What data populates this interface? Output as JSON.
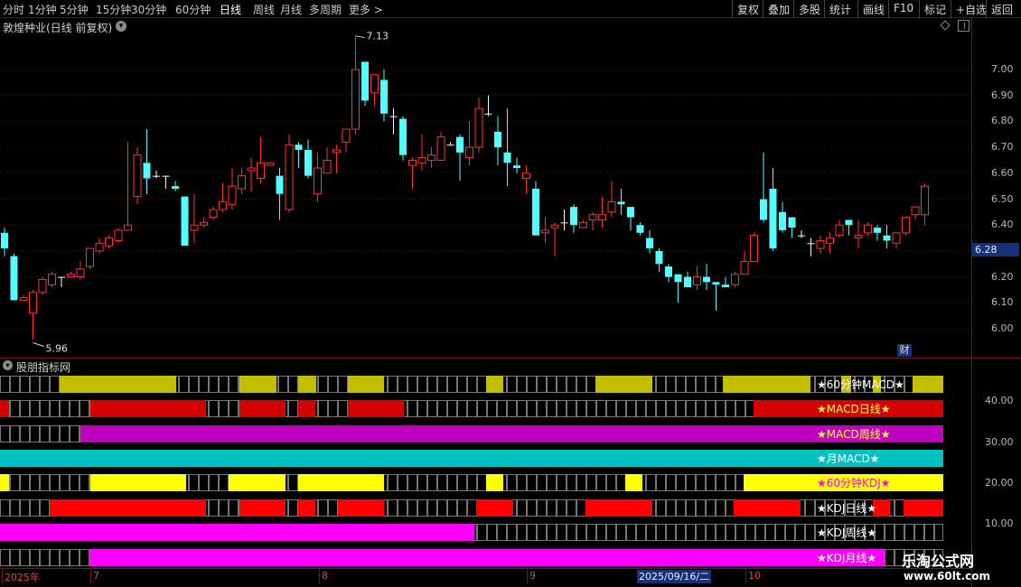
{
  "toolbar": {
    "periods": [
      "分时",
      "1分钟",
      "5分钟",
      "15分钟",
      "30分钟",
      "60分钟",
      "日线",
      "周线",
      "月线",
      "多周期",
      "更多 >"
    ],
    "active": "日线",
    "right": [
      "复权",
      "叠加",
      "多股",
      "统计",
      "画线",
      "F10",
      "标记",
      "+自选",
      "返回"
    ]
  },
  "chart_title": "敦煌种业(日线 前复权)",
  "ind_title": "股朋指标网",
  "current_price": "6.28",
  "cai_label": "财",
  "extremes": {
    "high": "7.13",
    "low": "5.96"
  },
  "price_axis": [
    "7.00",
    "6.90",
    "6.80",
    "6.70",
    "6.60",
    "6.50",
    "6.40",
    "6.30",
    "6.20",
    "6.10",
    "6.00"
  ],
  "ind_axis": [
    "40.00",
    "30.00",
    "20.00",
    "10.00"
  ],
  "date_labels": [
    "2025年",
    "7",
    "8",
    "9",
    "10"
  ],
  "cursor_date": "2025/09/16/二",
  "indicator_labels": [
    "★60分钟MACD★",
    "★MACD日线★",
    "★MACD周线★",
    "★月MACD★",
    "★60分钟KDJ★",
    "★KDJ日线★",
    "★KDJ周线★",
    "★KDJ月线★"
  ],
  "watermark": {
    "name": "乐淘公式网",
    "url": "www.60lt.com"
  },
  "colors": {
    "up": "#ff3232",
    "down": "#54ffff",
    "bg": "#000000",
    "grid": "#7a1414",
    "olive": "#c2be00",
    "red": "#d40000",
    "purple": "#c000c0",
    "teal": "#00c0c0",
    "yellow": "#ffff00",
    "brightred": "#ff0000",
    "magenta": "#ff00ff"
  },
  "chart_data": {
    "type": "candlestick",
    "ylim": [
      5.95,
      7.15
    ],
    "candles": [
      [
        6.37,
        6.31,
        6.39,
        6.28
      ],
      [
        6.28,
        6.11,
        6.29,
        6.11
      ],
      [
        6.11,
        6.12,
        6.13,
        6.11
      ],
      [
        6.06,
        6.14,
        6.15,
        5.96
      ],
      [
        6.14,
        6.19,
        6.2,
        6.13
      ],
      [
        6.17,
        6.21,
        6.22,
        6.16
      ],
      [
        6.2,
        6.2,
        6.2,
        6.16
      ],
      [
        6.2,
        6.21,
        6.22,
        6.2
      ],
      [
        6.2,
        6.23,
        6.26,
        6.19
      ],
      [
        6.24,
        6.31,
        6.31,
        6.23
      ],
      [
        6.3,
        6.33,
        6.35,
        6.29
      ],
      [
        6.32,
        6.35,
        6.36,
        6.31
      ],
      [
        6.34,
        6.38,
        6.39,
        6.33
      ],
      [
        6.38,
        6.4,
        6.72,
        6.38
      ],
      [
        6.51,
        6.67,
        6.7,
        6.48
      ],
      [
        6.64,
        6.58,
        6.77,
        6.52
      ],
      [
        6.59,
        6.59,
        6.61,
        6.58
      ],
      [
        6.59,
        6.59,
        6.59,
        6.54
      ],
      [
        6.55,
        6.54,
        6.57,
        6.53
      ],
      [
        6.51,
        6.32,
        6.51,
        6.32
      ],
      [
        6.38,
        6.4,
        6.52,
        6.33
      ],
      [
        6.4,
        6.41,
        6.43,
        6.39
      ],
      [
        6.43,
        6.46,
        6.47,
        6.42
      ],
      [
        6.46,
        6.49,
        6.56,
        6.45
      ],
      [
        6.48,
        6.55,
        6.62,
        6.46
      ],
      [
        6.54,
        6.59,
        6.62,
        6.52
      ],
      [
        6.61,
        6.62,
        6.66,
        6.53
      ],
      [
        6.58,
        6.64,
        6.74,
        6.56
      ],
      [
        6.63,
        6.64,
        6.64,
        6.64
      ],
      [
        6.59,
        6.52,
        6.62,
        6.42
      ],
      [
        6.46,
        6.71,
        6.75,
        6.45
      ],
      [
        6.71,
        6.69,
        6.72,
        6.62
      ],
      [
        6.69,
        6.59,
        6.73,
        6.58
      ],
      [
        6.52,
        6.62,
        6.68,
        6.49
      ],
      [
        6.6,
        6.65,
        6.7,
        6.6
      ],
      [
        6.68,
        6.69,
        6.71,
        6.6
      ],
      [
        6.72,
        6.77,
        6.77,
        6.68
      ],
      [
        6.77,
        7.0,
        7.13,
        6.75
      ],
      [
        7.03,
        6.88,
        7.02,
        6.86
      ],
      [
        6.91,
        6.98,
        6.98,
        6.86
      ],
      [
        6.96,
        6.83,
        7.0,
        6.8
      ],
      [
        6.82,
        6.82,
        6.85,
        6.75
      ],
      [
        6.81,
        6.67,
        6.82,
        6.65
      ],
      [
        6.63,
        6.65,
        6.66,
        6.54
      ],
      [
        6.64,
        6.66,
        6.75,
        6.61
      ],
      [
        6.65,
        6.67,
        6.7,
        6.62
      ],
      [
        6.65,
        6.74,
        6.76,
        6.65
      ],
      [
        6.71,
        6.71,
        6.72,
        6.71
      ],
      [
        6.74,
        6.68,
        6.75,
        6.57
      ],
      [
        6.66,
        6.7,
        6.8,
        6.63
      ],
      [
        6.7,
        6.85,
        6.89,
        6.68
      ],
      [
        6.83,
        6.83,
        6.9,
        6.82
      ],
      [
        6.76,
        6.7,
        6.82,
        6.63
      ],
      [
        6.68,
        6.64,
        6.85,
        6.55
      ],
      [
        6.63,
        6.62,
        6.66,
        6.6
      ],
      [
        6.58,
        6.6,
        6.63,
        6.52
      ],
      [
        6.54,
        6.36,
        6.57,
        6.36
      ],
      [
        6.37,
        6.38,
        6.43,
        6.33
      ],
      [
        6.39,
        6.4,
        6.41,
        6.28
      ],
      [
        6.41,
        6.41,
        6.46,
        6.38
      ],
      [
        6.47,
        6.4,
        6.48,
        6.37
      ],
      [
        6.39,
        6.41,
        6.42,
        6.39
      ],
      [
        6.42,
        6.44,
        6.45,
        6.38
      ],
      [
        6.42,
        6.44,
        6.51,
        6.39
      ],
      [
        6.45,
        6.49,
        6.57,
        6.43
      ],
      [
        6.49,
        6.48,
        6.54,
        6.44
      ],
      [
        6.47,
        6.43,
        6.47,
        6.38
      ],
      [
        6.4,
        6.37,
        6.41,
        6.36
      ],
      [
        6.35,
        6.31,
        6.38,
        6.29
      ],
      [
        6.3,
        6.25,
        6.31,
        6.22
      ],
      [
        6.24,
        6.2,
        6.25,
        6.18
      ],
      [
        6.21,
        6.18,
        6.21,
        6.1
      ],
      [
        6.2,
        6.16,
        6.22,
        6.16
      ],
      [
        6.17,
        6.2,
        6.24,
        6.15
      ],
      [
        6.2,
        6.18,
        6.25,
        6.15
      ],
      [
        6.18,
        6.17,
        6.18,
        6.07
      ],
      [
        6.17,
        6.16,
        6.2,
        6.16
      ],
      [
        6.17,
        6.21,
        6.22,
        6.16
      ],
      [
        6.21,
        6.26,
        6.3,
        6.21
      ],
      [
        6.26,
        6.36,
        6.37,
        6.27
      ],
      [
        6.5,
        6.42,
        6.68,
        6.41
      ],
      [
        6.54,
        6.31,
        6.62,
        6.3
      ],
      [
        6.45,
        6.38,
        6.49,
        6.37
      ],
      [
        6.43,
        6.39,
        6.42,
        6.35
      ],
      [
        6.36,
        6.36,
        6.38,
        6.35
      ],
      [
        6.33,
        6.33,
        6.35,
        6.28
      ],
      [
        6.31,
        6.34,
        6.36,
        6.29
      ],
      [
        6.33,
        6.35,
        6.37,
        6.29
      ],
      [
        6.36,
        6.4,
        6.42,
        6.35
      ],
      [
        6.42,
        6.4,
        6.42,
        6.36
      ],
      [
        6.35,
        6.36,
        6.42,
        6.31
      ],
      [
        6.37,
        6.4,
        6.41,
        6.36
      ],
      [
        6.39,
        6.37,
        6.4,
        6.34
      ],
      [
        6.36,
        6.34,
        6.4,
        6.31
      ],
      [
        6.33,
        6.37,
        6.37,
        6.31
      ],
      [
        6.37,
        6.43,
        6.43,
        6.36
      ],
      [
        6.44,
        6.47,
        6.47,
        6.42
      ],
      [
        6.44,
        6.55,
        6.56,
        6.4
      ]
    ]
  }
}
